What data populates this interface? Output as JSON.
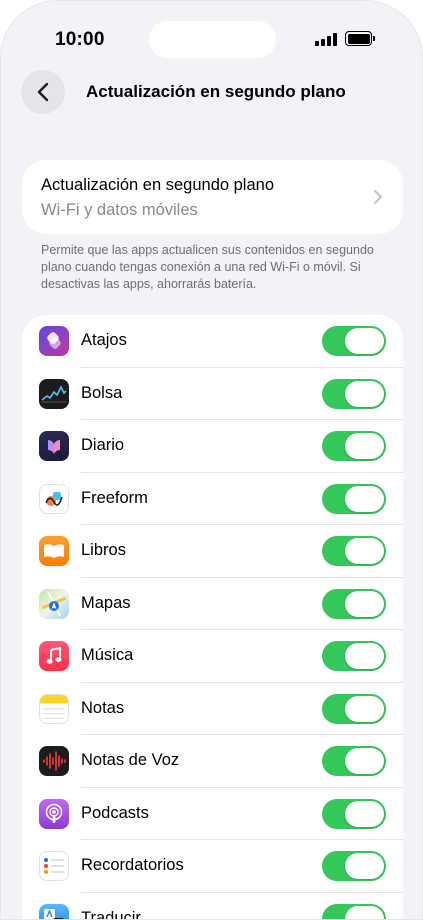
{
  "status_bar": {
    "time": "10:00",
    "signal_icon": "signal-bars-icon",
    "battery_icon": "battery-full-icon"
  },
  "nav": {
    "back_icon": "chevron-left-icon",
    "title": "Actualización en segundo plano"
  },
  "setting": {
    "title": "Actualización en segundo plano",
    "value": "Wi-Fi y datos móviles",
    "chevron_icon": "chevron-right-icon"
  },
  "footnote": "Permite que las apps actualicen sus contenidos en segundo plano cuando tengas conexión a una red Wi-Fi o móvil. Si desactivas las apps, ahorrarás batería.",
  "colors": {
    "toggle_on": "#34c759",
    "background": "#f2f2f7",
    "secondary_text": "#8a8a8e"
  },
  "apps": [
    {
      "label": "Atajos",
      "icon": "shortcuts-icon",
      "enabled": true
    },
    {
      "label": "Bolsa",
      "icon": "stocks-icon",
      "enabled": true
    },
    {
      "label": "Diario",
      "icon": "journal-icon",
      "enabled": true
    },
    {
      "label": "Freeform",
      "icon": "freeform-icon",
      "enabled": true
    },
    {
      "label": "Libros",
      "icon": "books-icon",
      "enabled": true
    },
    {
      "label": "Mapas",
      "icon": "maps-icon",
      "enabled": true
    },
    {
      "label": "Música",
      "icon": "music-icon",
      "enabled": true
    },
    {
      "label": "Notas",
      "icon": "notes-icon",
      "enabled": true
    },
    {
      "label": "Notas de Voz",
      "icon": "voice-memos-icon",
      "enabled": true
    },
    {
      "label": "Podcasts",
      "icon": "podcasts-icon",
      "enabled": true
    },
    {
      "label": "Recordatorios",
      "icon": "reminders-icon",
      "enabled": true
    },
    {
      "label": "Traducir",
      "icon": "translate-icon",
      "enabled": true
    }
  ]
}
